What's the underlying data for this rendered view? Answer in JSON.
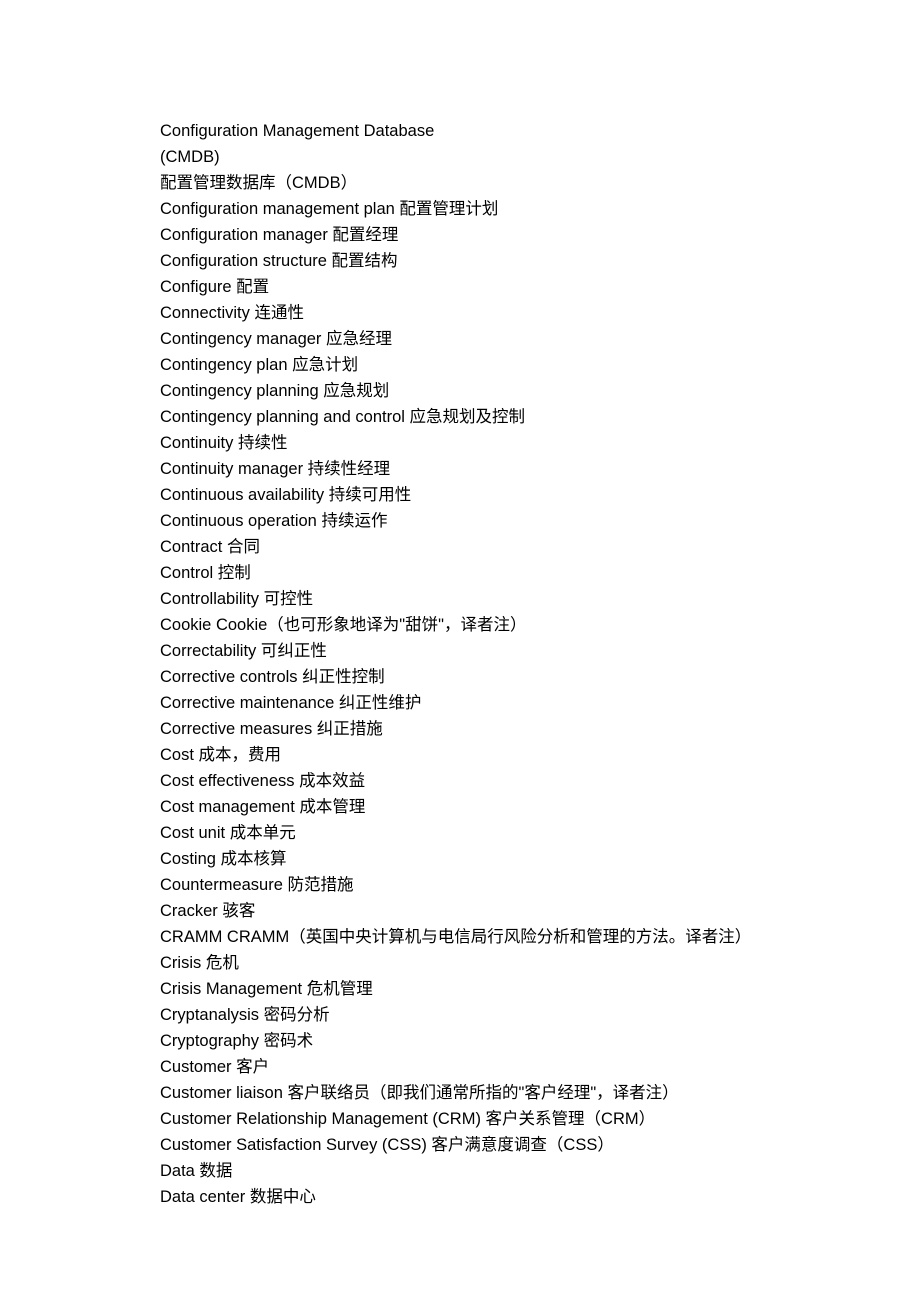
{
  "lines": [
    "Configuration Management Database",
    "(CMDB)",
    "配置管理数据库（CMDB）",
    "Configuration management plan 配置管理计划",
    "Configuration manager 配置经理",
    "Configuration structure 配置结构",
    "Configure 配置",
    "Connectivity 连通性",
    "Contingency manager 应急经理",
    "Contingency plan 应急计划",
    "Contingency planning 应急规划",
    "Contingency planning and control 应急规划及控制",
    "Continuity 持续性",
    "Continuity manager 持续性经理",
    "Continuous availability 持续可用性",
    "Continuous operation 持续运作",
    "Contract 合同",
    "Control 控制",
    "Controllability 可控性",
    "Cookie Cookie（也可形象地译为\"甜饼\"，译者注）",
    "Correctability 可纠正性",
    "Corrective controls 纠正性控制",
    "Corrective maintenance 纠正性维护",
    "Corrective measures 纠正措施",
    "Cost 成本，费用",
    "Cost effectiveness 成本效益",
    "Cost management 成本管理",
    "Cost unit 成本单元",
    "Costing 成本核算",
    "Countermeasure 防范措施",
    "Cracker 骇客",
    "CRAMM CRAMM（英国中央计算机与电信局行风险分析和管理的方法。译者注）",
    "Crisis 危机",
    "Crisis Management 危机管理",
    "Cryptanalysis 密码分析",
    "Cryptography 密码术",
    "Customer 客户",
    "Customer liaison 客户联络员（即我们通常所指的\"客户经理\"，译者注）",
    "Customer Relationship Management (CRM) 客户关系管理（CRM）",
    "Customer Satisfaction Survey (CSS) 客户满意度调查（CSS）",
    "Data 数据",
    "Data center 数据中心"
  ]
}
